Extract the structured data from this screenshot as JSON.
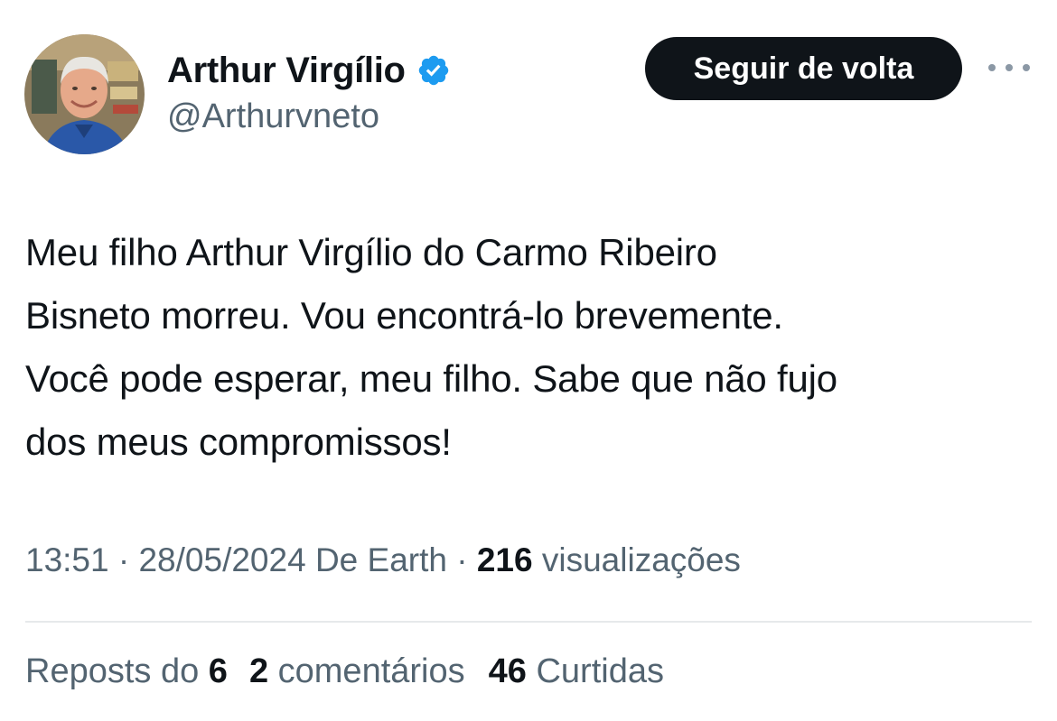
{
  "author": {
    "display_name": "Arthur Virgílio",
    "handle": "@Arthurvneto",
    "verified": true,
    "verified_color": "#1d9bf0"
  },
  "actions": {
    "follow_label": "Seguir de volta",
    "more_icon": "more-horizontal-icon"
  },
  "tweet": {
    "lines": [
      "Meu filho Arthur Virgílio do Carmo Ribeiro",
      "Bisneto morreu. Vou encontrá-lo brevemente.",
      "Você pode esperar, meu filho. Sabe que não fujo",
      "dos meus compromissos!"
    ]
  },
  "meta": {
    "time": "13:51",
    "date": "28/05/2024",
    "source": "De Earth",
    "views_count": "216",
    "views_label": "visualizações",
    "separator": "·"
  },
  "stats": {
    "reposts_label": "Reposts do",
    "reposts_count": "6",
    "comments_count": "2",
    "comments_label": "comentários",
    "likes_count": "46",
    "likes_label": "Curtidas"
  }
}
